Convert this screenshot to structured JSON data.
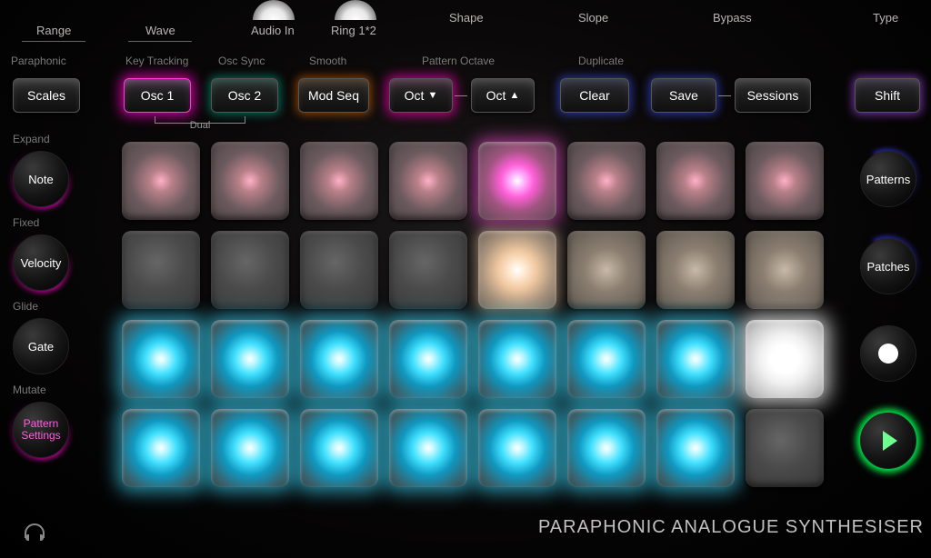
{
  "top": {
    "range": "Range",
    "wave": "Wave",
    "audio_in": "Audio In",
    "ring": "Ring 1*2",
    "shape": "Shape",
    "slope": "Slope",
    "bypass": "Bypass",
    "type": "Type"
  },
  "btn_labels": {
    "paraphonic": "Paraphonic",
    "key_tracking": "Key Tracking",
    "osc_sync": "Osc Sync",
    "smooth": "Smooth",
    "pattern_octave": "Pattern Octave",
    "duplicate": "Duplicate",
    "dual": "Dual"
  },
  "buttons": {
    "scales": "Scales",
    "osc1": "Osc 1",
    "osc2": "Osc 2",
    "mod_seq": "Mod Seq",
    "oct_down": "Oct",
    "oct_up": "Oct",
    "clear": "Clear",
    "save": "Save",
    "sessions": "Sessions",
    "shift": "Shift"
  },
  "left": {
    "expand": "Expand",
    "note": "Note",
    "fixed": "Fixed",
    "velocity": "Velocity",
    "glide": "Glide",
    "gate": "Gate",
    "mutate": "Mutate",
    "pattern_settings": "Pattern\nSettings"
  },
  "right": {
    "patterns": "Patterns",
    "patches": "Patches"
  },
  "footer": "PARAPHONIC ANALOGUE SYNTHESISER",
  "pads": [
    [
      "pink-dim",
      "pink-dim",
      "pink-dim",
      "pink-dim",
      "pink-bright",
      "pink-dim",
      "pink-dim",
      "pink-dim"
    ],
    [
      "off",
      "off",
      "off",
      "off",
      "warm",
      "warm-dim",
      "warm-dim",
      "warm-dim"
    ],
    [
      "cyan",
      "cyan",
      "cyan",
      "cyan",
      "cyan",
      "cyan",
      "cyan",
      "white"
    ],
    [
      "cyan",
      "cyan",
      "cyan",
      "cyan",
      "cyan",
      "cyan",
      "cyan",
      "off"
    ]
  ],
  "colors": {
    "magenta": "#ff2ed0",
    "cyan": "#40e0ff",
    "green": "#3fff60"
  }
}
